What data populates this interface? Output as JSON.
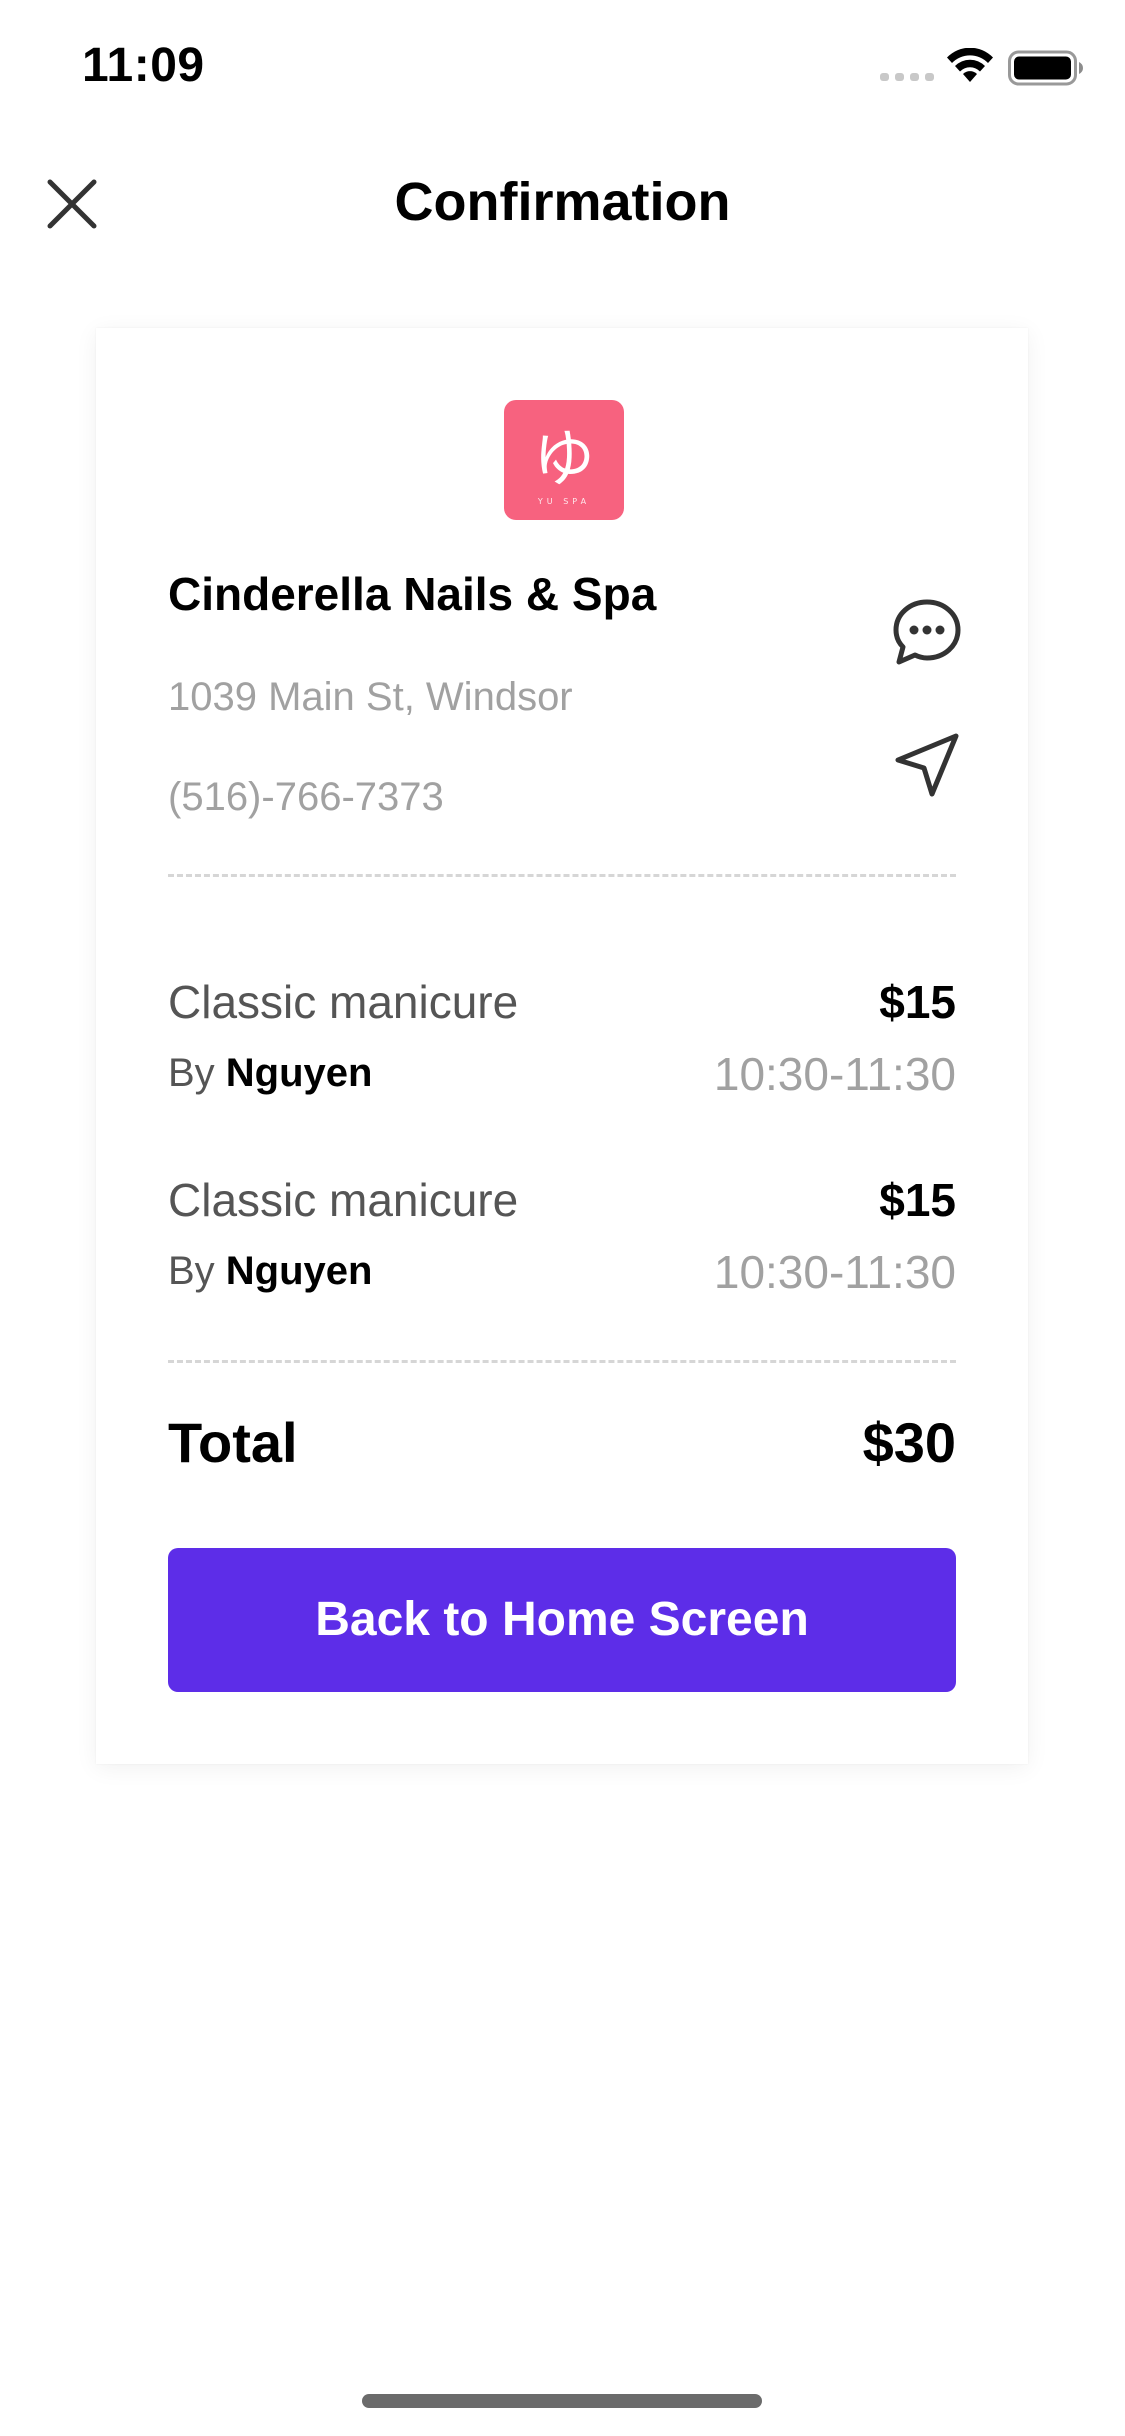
{
  "status_bar": {
    "time": "11:09"
  },
  "header": {
    "title": "Confirmation",
    "close_icon": "close-icon"
  },
  "salon": {
    "logo_icon": "yu-spa-logo",
    "logo_text": "ゆ YU SPA",
    "logo_color": "#f7627f",
    "name": "Cinderella Nails & Spa",
    "address": "1039 Main St, Windsor",
    "phone": "(516)-766-7373",
    "chat_icon": "chat-bubble-icon",
    "navigate_icon": "navigation-arrow-icon"
  },
  "services": [
    {
      "name": "Classic manicure",
      "by_prefix": "By ",
      "staff": "Nguyen",
      "price": "$15",
      "time": "10:30-11:30"
    },
    {
      "name": "Classic manicure",
      "by_prefix": "By ",
      "staff": "Nguyen",
      "price": "$15",
      "time": "10:30-11:30"
    }
  ],
  "total": {
    "label": "Total",
    "value": "$30"
  },
  "actions": {
    "back_home_label": "Back to Home Screen",
    "button_color": "#5d2de8"
  }
}
